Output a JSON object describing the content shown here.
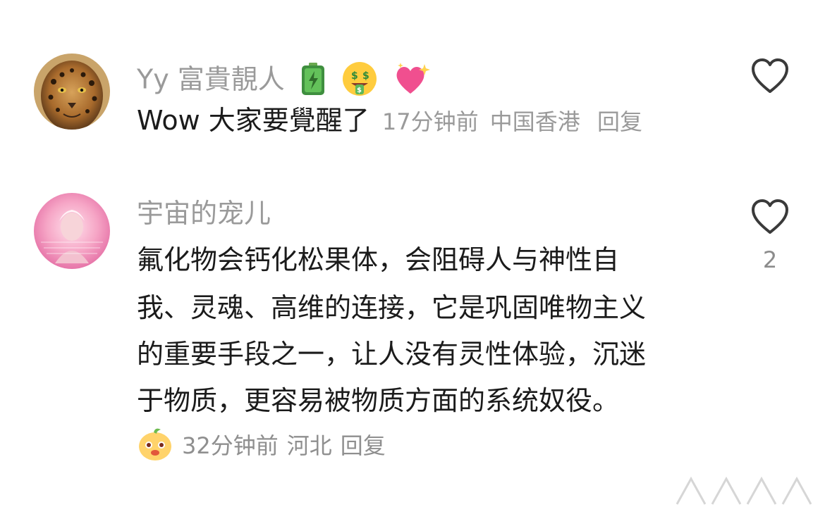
{
  "comments": [
    {
      "username": "Yy 富貴靚人",
      "emojis": [
        "battery-icon",
        "money-mouth-icon",
        "sparkling-heart-icon"
      ],
      "text": "Wow 大家要覺醒了",
      "time": "17分钟前",
      "location": "中国香港",
      "reply_label": "回复",
      "likes": ""
    },
    {
      "username": "宇宙的宠儿",
      "text_lines": [
        "氟化物会钙化松果体，会阻碍人与神性自",
        "我、灵魂、高维的连接，它是巩固唯物主义",
        "的重要手段之一，让人没有灵性体验，沉迷",
        "于物质，更容易被物质方面的系统奴役。"
      ],
      "time": "32分钟前",
      "location": "河北",
      "reply_label": "回复",
      "likes": "2"
    }
  ],
  "colors": {
    "username": "#9a9a9a",
    "body": "#1b1b1b",
    "meta": "#8f8f8f",
    "heart_outline": "#3a3a3a"
  }
}
